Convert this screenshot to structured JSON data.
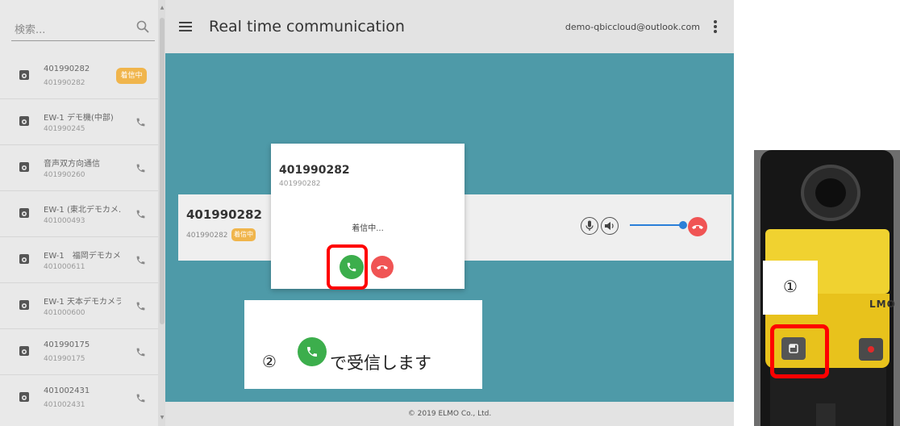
{
  "sidebar": {
    "search_placeholder": "検索...",
    "items": [
      {
        "title": "401990282",
        "subtitle": "401990282",
        "badge": "着信中"
      },
      {
        "title": "EW-1 デモ機(中部)",
        "subtitle": "401990245"
      },
      {
        "title": "音声双方向通信",
        "subtitle": "401990260"
      },
      {
        "title": "EW-1 (東北デモカメ…",
        "subtitle": "401000493"
      },
      {
        "title": "EW-1　福岡デモカメ…",
        "subtitle": "401000611"
      },
      {
        "title": "EW-1 天本デモカメラ",
        "subtitle": "401000600"
      },
      {
        "title": "401990175",
        "subtitle": "401990175"
      },
      {
        "title": "401002431",
        "subtitle": "401002431"
      }
    ]
  },
  "header": {
    "title": "Real time communication",
    "user_email": "demo-qbiccloud@outlook.com"
  },
  "call_card": {
    "title": "401990282",
    "subtitle": "401990282",
    "badge": "着信中",
    "volume_level": 0.85
  },
  "dialog": {
    "title": "401990282",
    "subtitle": "401990282",
    "status": "着信中..."
  },
  "footer": {
    "copyright": "© 2019 ELMO Co., Ltd."
  },
  "callout": {
    "number": "②",
    "text": "で受信します"
  },
  "device": {
    "step_label": "①",
    "logo": "LMO"
  },
  "colors": {
    "accent_teal": "#4e9aa8",
    "accept_green": "#3cae4c",
    "decline_red": "#f05454",
    "badge_orange": "#f0b54c",
    "highlight_red": "#ff0000"
  },
  "icons": {
    "search": "search-icon",
    "menu": "menu-icon",
    "more": "more-vert-icon",
    "camera": "camera-icon",
    "phone": "phone-icon",
    "mic": "mic-icon",
    "volume": "volume-icon",
    "hangup": "hangup-icon"
  }
}
